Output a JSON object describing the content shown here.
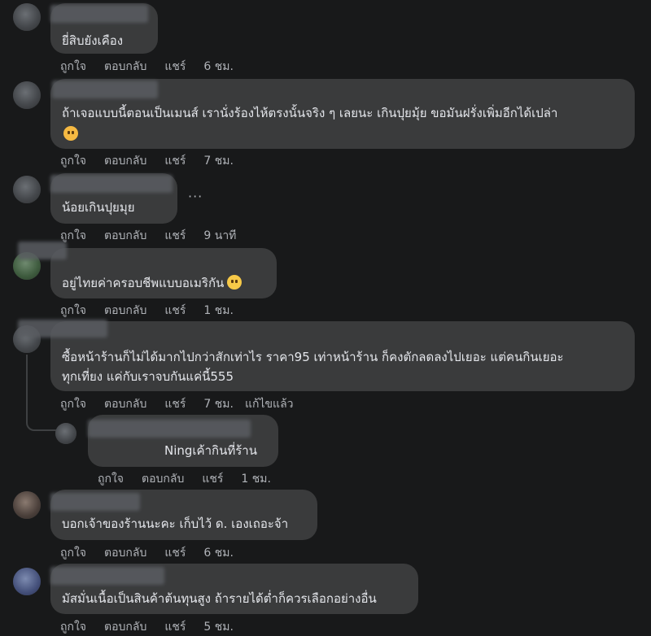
{
  "comments": [
    {
      "text": "ยี่สิบยังเคือง",
      "like": "ถูกใจ",
      "reply": "ตอบกลับ",
      "share": "แชร์",
      "time": "6 ชม."
    },
    {
      "text": "ถ้าเจอแบบนี้ตอนเป็นเมนส์ เรานั่งร้องไห้ตรงนั้นจริง ๆ เลยนะ เกินปุยมุ้ย ขอมันฝรั่งเพิ่มอีกได้เปล่า",
      "emoji": "crying-face-icon",
      "like": "ถูกใจ",
      "reply": "ตอบกลับ",
      "share": "แชร์",
      "time": "7 ชม."
    },
    {
      "text": "น้อยเกินปุยมุย",
      "more": "···",
      "like": "ถูกใจ",
      "reply": "ตอบกลับ",
      "share": "แชร์",
      "time": "9 นาที"
    },
    {
      "text": "อยู่ไทยค่าครอบชีพแบบอเมริกัน",
      "emoji": "sweat-smile-icon",
      "like": "ถูกใจ",
      "reply": "ตอบกลับ",
      "share": "แชร์",
      "time": "1 ชม."
    },
    {
      "text_line1": "ซื้อหน้าร้านก็ไม่ได้มากไปกว่าสักเท่าไร ราคา95 เท่าหน้าร้าน ก็คงตักลดลงไปเยอะ แต่คนกินเยอะ",
      "text_line2": "ทุกเที่ยง แค่กับเราจบกันแค่นี้555",
      "like": "ถูกใจ",
      "reply": "ตอบกลับ",
      "share": "แชร์",
      "time": "7 ชม.",
      "edited": "แก้ไขแล้ว"
    },
    {
      "text": "Ningเค้ากินที่ร้าน",
      "like": "ถูกใจ",
      "reply": "ตอบกลับ",
      "share": "แชร์",
      "time": "1 ชม."
    },
    {
      "text": "บอกเจ้าของร้านนะคะ เก็บไว้ ด. เองเถอะจ้า",
      "like": "ถูกใจ",
      "reply": "ตอบกลับ",
      "share": "แชร์",
      "time": "6 ชม."
    },
    {
      "text": "มัสมั่นเนื้อเป็นสินค้าต้นทุนสูง ถ้ารายได้ต่ำก็ควรเลือกอย่างอื่น",
      "like": "ถูกใจ",
      "reply": "ตอบกลับ",
      "share": "แชร์",
      "time": "5 ชม."
    }
  ],
  "colors": {
    "background": "#18191a",
    "bubble": "#3a3b3c",
    "text": "#e4e6eb",
    "meta": "#b0b3b8"
  }
}
